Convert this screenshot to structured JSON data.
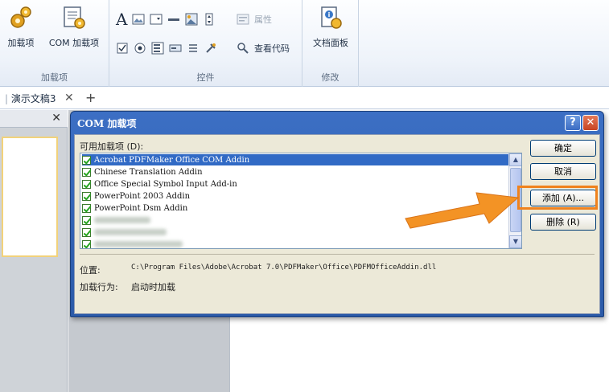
{
  "ribbon": {
    "groups": [
      {
        "caption": "加载项",
        "buttons": [
          {
            "label": "加载项",
            "icon": "addin-gears-icon"
          },
          {
            "label": "COM 加载项",
            "icon": "com-addin-icon"
          }
        ]
      },
      {
        "caption": "控件",
        "buttons": [
          {
            "label": "属性",
            "icon": "properties-icon"
          },
          {
            "label": "查看代码",
            "icon": "view-code-icon"
          }
        ]
      },
      {
        "caption": "修改",
        "buttons": [
          {
            "label": "文档面板",
            "icon": "document-panel-icon"
          }
        ]
      }
    ],
    "text_control_glyph": "A"
  },
  "tabs": {
    "doc_tab": "演示文稿3",
    "close_glyph": "✕",
    "add_glyph": "+"
  },
  "left_pane": {
    "close_glyph": "✕"
  },
  "dialog": {
    "title": "COM 加载项",
    "help_glyph": "?",
    "close_glyph": "✕",
    "available_label": "可用加载项 (D):",
    "addins": [
      {
        "name": "Acrobat PDFMaker Office COM Addin",
        "checked": true,
        "selected": true
      },
      {
        "name": "Chinese Translation Addin",
        "checked": true,
        "selected": false
      },
      {
        "name": "Office Special Symbol Input Add-in",
        "checked": true,
        "selected": false
      },
      {
        "name": "PowerPoint 2003 Addin",
        "checked": true,
        "selected": false
      },
      {
        "name": "PowerPoint Dsm Addin",
        "checked": true,
        "selected": false
      }
    ],
    "location_label": "位置:",
    "location_value": "C:\\Program Files\\Adobe\\Acrobat 7.0\\PDFMaker\\Office\\PDFMOfficeAddin.dll",
    "behavior_label": "加载行为:",
    "behavior_value": "启动时加载",
    "buttons": {
      "ok": "确定",
      "cancel": "取消",
      "add": "添加 (A)...",
      "remove": "删除 (R)"
    },
    "scroll_up_glyph": "▲",
    "scroll_down_glyph": "▼"
  },
  "colors": {
    "highlight": "#f0821c",
    "dialog_title": "#2b5aa8",
    "selection": "#316ac5"
  }
}
